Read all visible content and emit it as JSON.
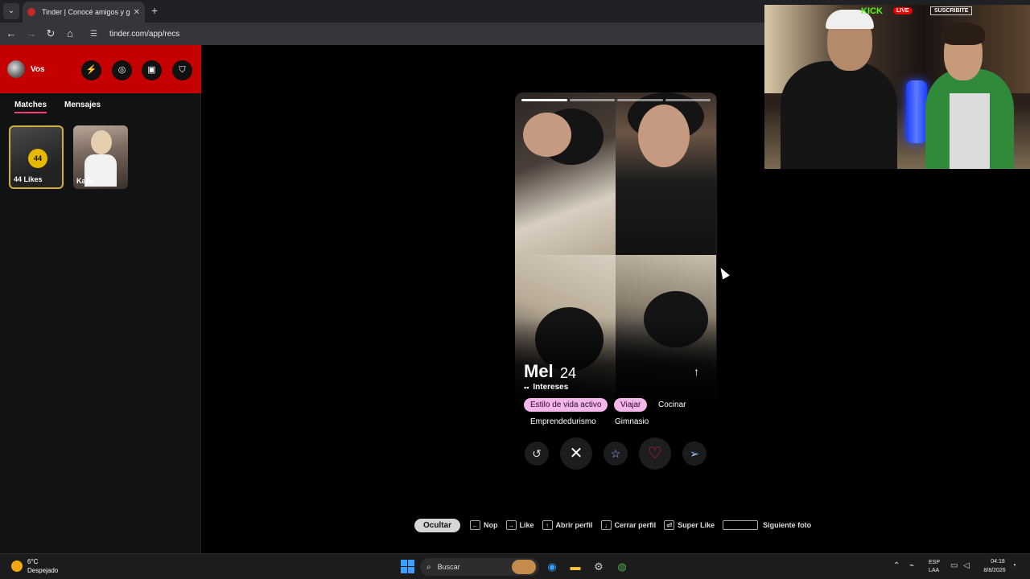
{
  "browser": {
    "tab_title": "Tinder | Conocé amigos y gente",
    "url": "tinder.com/app/recs"
  },
  "sidebar": {
    "user_name": "Vos",
    "tabs": [
      "Matches",
      "Mensajes"
    ],
    "likes": {
      "count": "44",
      "label": "44 Likes"
    },
    "matches": [
      {
        "name": "Karu"
      }
    ]
  },
  "card": {
    "name": "Mel",
    "age": "24",
    "photos_total": 4,
    "photo_current": 1,
    "interests_label": "Intereses",
    "interests": [
      {
        "label": "Estilo de vida activo",
        "shared": true
      },
      {
        "label": "Viajar",
        "shared": true
      },
      {
        "label": "Cocinar",
        "shared": false
      },
      {
        "label": "Emprendedurismo",
        "shared": false
      },
      {
        "label": "Gimnasio",
        "shared": false
      }
    ]
  },
  "actions": [
    "rewind-icon",
    "close-icon",
    "star-icon",
    "heart-icon",
    "send-icon"
  ],
  "hints": {
    "hide": "Ocultar",
    "items": [
      "Nop",
      "Like",
      "Abrir perfil",
      "Cerrar perfil",
      "Super Like",
      "Siguiente foto"
    ]
  },
  "overlay": {
    "platform": "KICK",
    "live": "LIVE",
    "subscribe": "SUSCRIBITE"
  },
  "taskbar": {
    "temp": "6°C",
    "condition": "Despejado",
    "search": "Buscar",
    "lang": "ESP",
    "layout": "LAA",
    "time": "04:18",
    "date": "8/8/2026"
  },
  "colors": {
    "tinder_red": "#c50000",
    "chip_pink": "#f3b6e8",
    "gold": "#d4af37",
    "heart_red": "#e0223a"
  }
}
